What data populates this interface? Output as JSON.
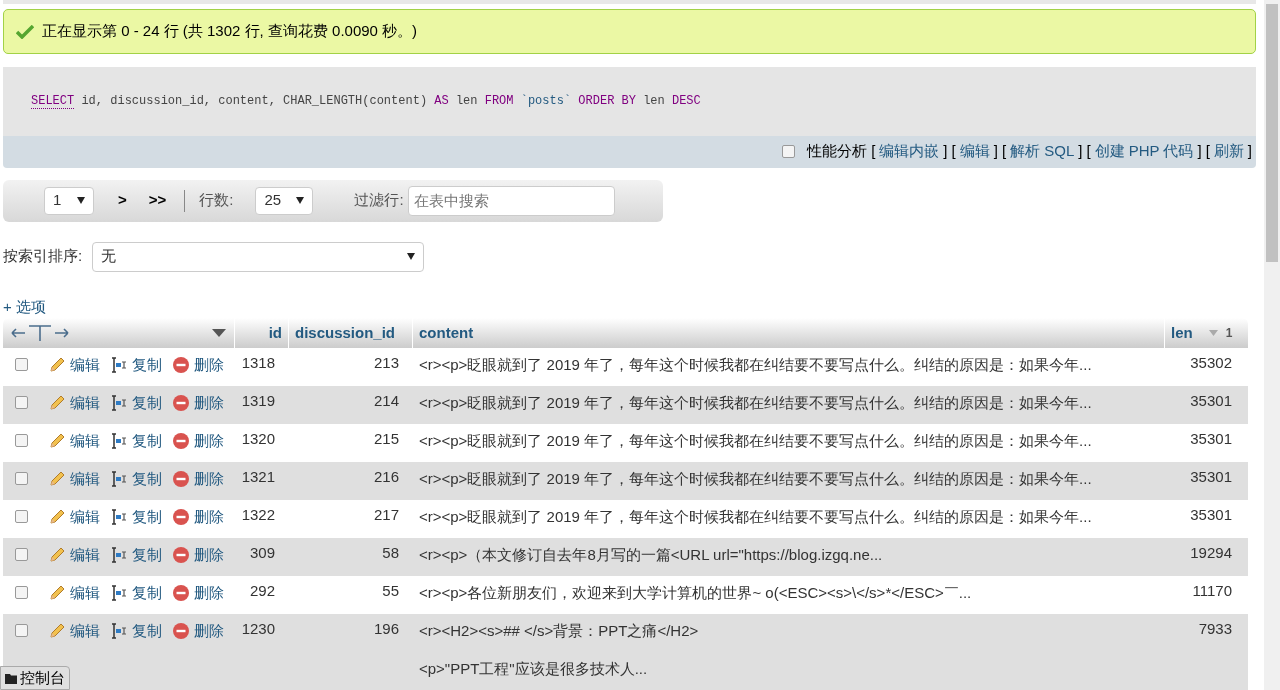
{
  "success_message": "正在显示第 0 - 24 行 (共 1302 行, 查询花费 0.0090 秒。)",
  "sql": [
    {
      "kind": "keyword",
      "text": "SELECT"
    },
    {
      "kind": "plain",
      "text": " id, discussion_id, content, CHAR_LENGTH(content) "
    },
    {
      "kind": "keyword",
      "text": "AS"
    },
    {
      "kind": "plain",
      "text": " len "
    },
    {
      "kind": "keyword",
      "text": "FROM "
    },
    {
      "kind": "name",
      "text": "`posts`"
    },
    {
      "kind": "keyword",
      "text": " ORDER BY"
    },
    {
      "kind": "plain",
      "text": " len "
    },
    {
      "kind": "keyword",
      "text": "DESC"
    }
  ],
  "query_options": {
    "profiling": {
      "label": "性能分析",
      "checked": false
    },
    "links": [
      {
        "open": "[",
        "label": "编辑内嵌",
        "close": "]"
      },
      {
        "open": "[",
        "label": "编辑",
        "close": "]"
      },
      {
        "open": "[",
        "label": "解析 SQL",
        "close": "]"
      },
      {
        "open": "[",
        "label": "创建 PHP 代码",
        "close": "]"
      },
      {
        "open": "[",
        "label": "刷新",
        "close": "]"
      }
    ]
  },
  "navigation": {
    "page": "1",
    "next": ">",
    "last": ">>",
    "rows_label": "行数:",
    "rows": "25",
    "filter_label": "过滤行:",
    "filter_placeholder": "在表中搜索"
  },
  "sort_by_key": {
    "label": "按索引排序:",
    "value": "无"
  },
  "options_link": "+ 选项",
  "table": {
    "columns": [
      "id",
      "discussion_id",
      "content",
      "len"
    ],
    "sort_order": "1",
    "rows": [
      {
        "checked": false,
        "actions": [
          "编辑",
          "复制",
          "删除"
        ],
        "id": "1318",
        "discussion_id": "213",
        "content": [
          "<r><p>眨眼就到了 2019 年了，每年这个时候我都在纠结要不要写点什么。纠结的原因是：如果今年..."
        ],
        "len": "35302"
      },
      {
        "checked": false,
        "actions": [
          "编辑",
          "复制",
          "删除"
        ],
        "id": "1319",
        "discussion_id": "214",
        "content": [
          "<r><p>眨眼就到了 2019 年了，每年这个时候我都在纠结要不要写点什么。纠结的原因是：如果今年..."
        ],
        "len": "35301"
      },
      {
        "checked": false,
        "actions": [
          "编辑",
          "复制",
          "删除"
        ],
        "id": "1320",
        "discussion_id": "215",
        "content": [
          "<r><p>眨眼就到了 2019 年了，每年这个时候我都在纠结要不要写点什么。纠结的原因是：如果今年..."
        ],
        "len": "35301"
      },
      {
        "checked": false,
        "actions": [
          "编辑",
          "复制",
          "删除"
        ],
        "id": "1321",
        "discussion_id": "216",
        "content": [
          "<r><p>眨眼就到了 2019 年了，每年这个时候我都在纠结要不要写点什么。纠结的原因是：如果今年..."
        ],
        "len": "35301"
      },
      {
        "checked": false,
        "actions": [
          "编辑",
          "复制",
          "删除"
        ],
        "id": "1322",
        "discussion_id": "217",
        "content": [
          "<r><p>眨眼就到了 2019 年了，每年这个时候我都在纠结要不要写点什么。纠结的原因是：如果今年..."
        ],
        "len": "35301"
      },
      {
        "checked": false,
        "actions": [
          "编辑",
          "复制",
          "删除"
        ],
        "id": "309",
        "discussion_id": "58",
        "content": [
          "<r><p>（本文修订自去年8月写的一篇<URL url=\"https://blog.izgq.ne..."
        ],
        "len": "19294"
      },
      {
        "checked": false,
        "actions": [
          "编辑",
          "复制",
          "删除"
        ],
        "id": "292",
        "discussion_id": "55",
        "content": [
          "<r><p>各位新朋友们，欢迎来到大学计算机的世界~ o(<ESC><s>\\</s>*</ESC>￣..."
        ],
        "len": "11170"
      },
      {
        "checked": false,
        "actions": [
          "编辑",
          "复制",
          "删除"
        ],
        "id": "1230",
        "discussion_id": "196",
        "content": [
          "<r><H2><s>## </s>背景：PPT之痛</H2>",
          "<p>\"PPT工程\"应该是很多技术人..."
        ],
        "len": "7933"
      }
    ]
  },
  "console_button": "控制台"
}
